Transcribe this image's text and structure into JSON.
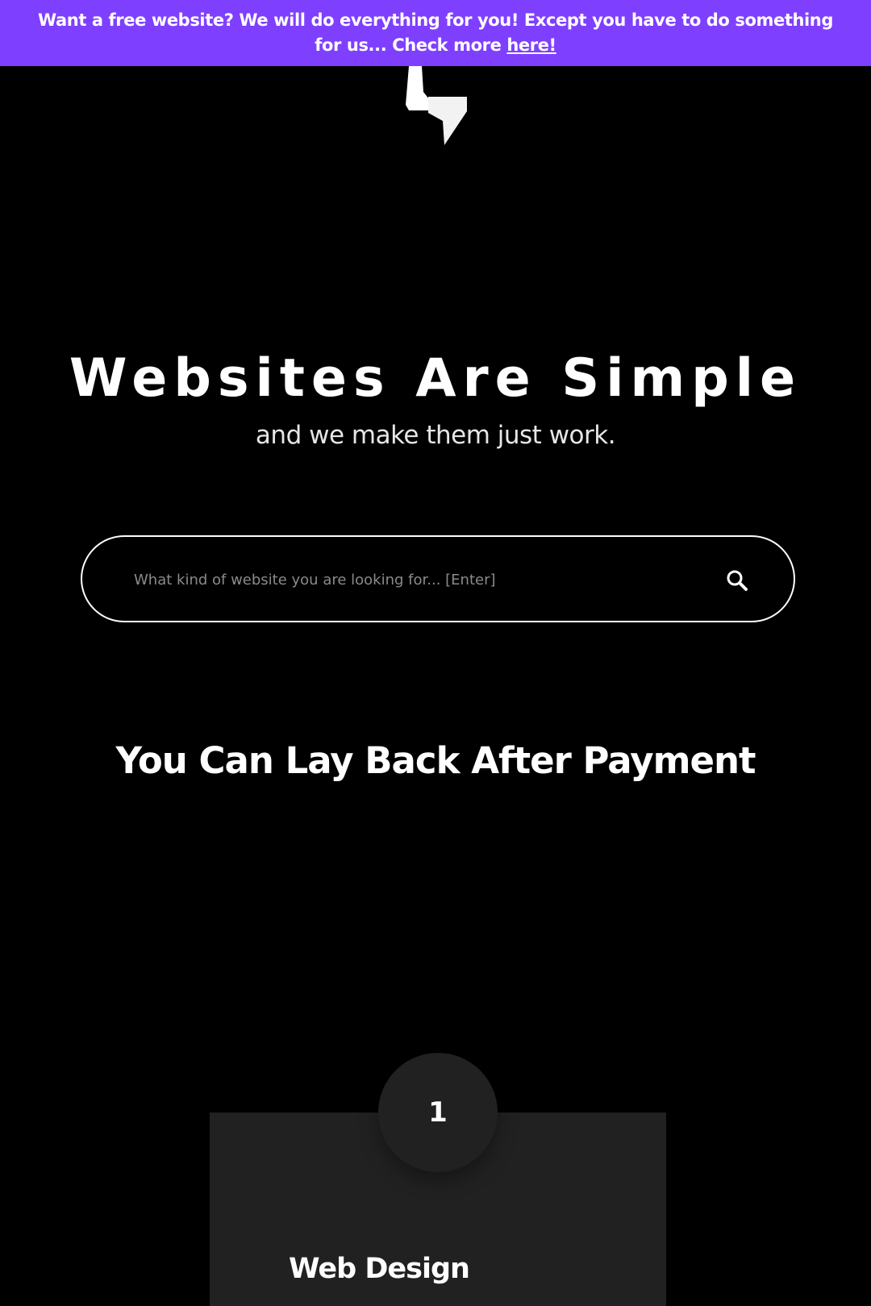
{
  "announcement": {
    "text": "Want a free website? We will do everything for you! Except you have to do something for us... Check more ",
    "link_label": "here!"
  },
  "hero": {
    "title": "Websites Are Simple",
    "subtitle": "and we make them just work."
  },
  "search": {
    "placeholder": "What kind of website you are looking for... [Enter]",
    "icon": "search-icon"
  },
  "section": {
    "title": "You Can Lay Back After Payment"
  },
  "steps": [
    {
      "number": "1",
      "title": "Web Design"
    }
  ],
  "colors": {
    "announcement_bg": "#7f3fff",
    "page_bg": "#000000",
    "card_bg": "#212121",
    "text": "#ffffff"
  },
  "logo": {
    "icon": "lightning-bolt-logo-icon"
  }
}
